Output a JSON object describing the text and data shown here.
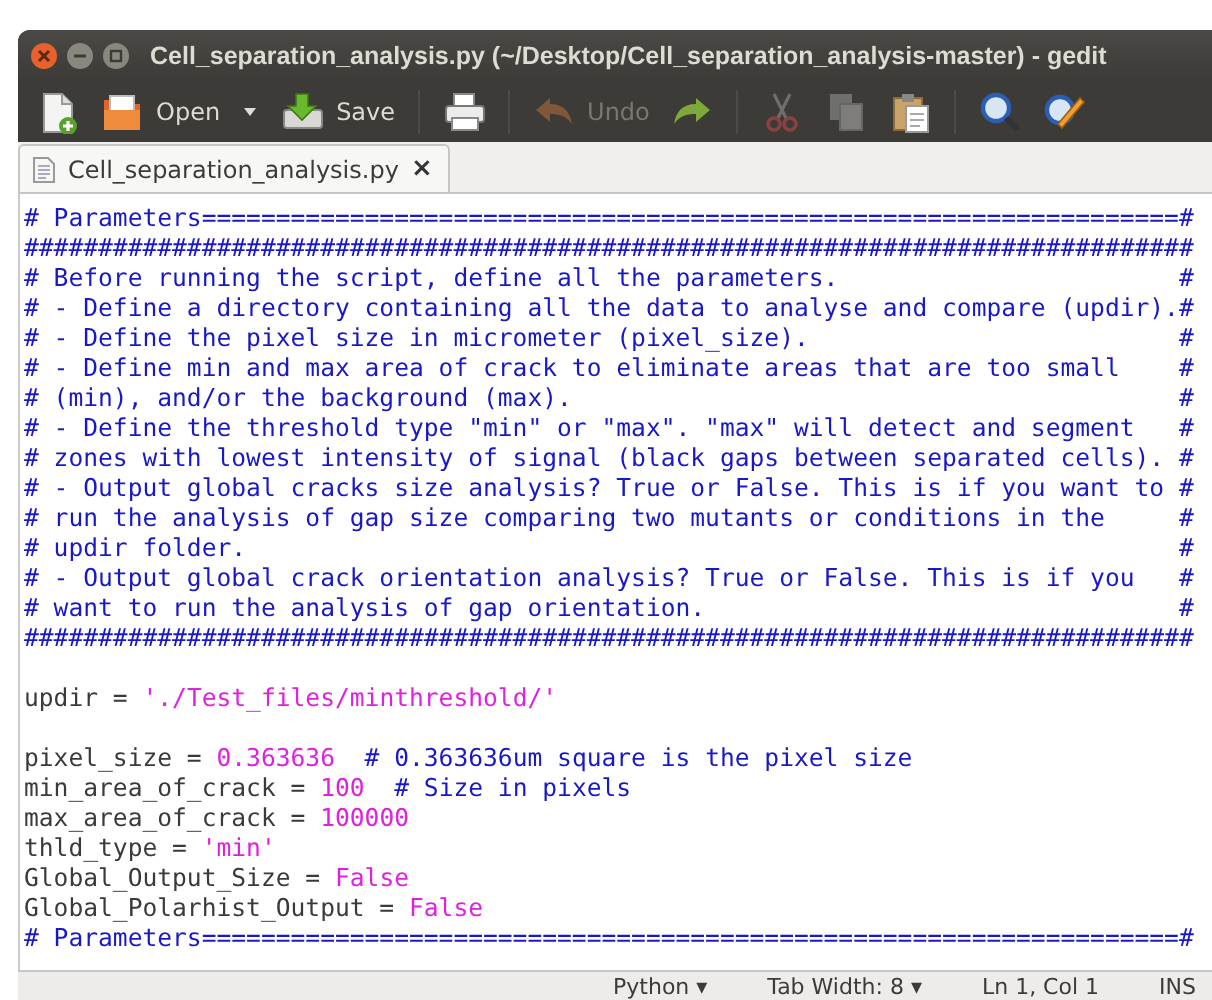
{
  "window": {
    "title": "Cell_separation_analysis.py (~/Desktop/Cell_separation_analysis-master) - gedit"
  },
  "toolbar": [
    {
      "kind": "new",
      "disabled": false
    },
    {
      "kind": "open",
      "label": "Open",
      "disabled": false
    },
    {
      "kind": "save",
      "label": "Save",
      "disabled": false
    },
    {
      "kind": "print",
      "disabled": false
    },
    {
      "kind": "undo",
      "label": "Undo",
      "disabled": true
    },
    {
      "kind": "redo",
      "disabled": false
    },
    {
      "kind": "cut",
      "disabled": true
    },
    {
      "kind": "copy",
      "disabled": true
    },
    {
      "kind": "paste",
      "disabled": false
    },
    {
      "kind": "search",
      "disabled": false
    },
    {
      "kind": "replace",
      "disabled": false
    }
  ],
  "tabs": [
    {
      "label": "Cell_separation_analysis.py",
      "selected": true,
      "close": "×"
    }
  ],
  "lines": [
    {
      "kind": "code",
      "tokens": [
        {
          "kind": "comment",
          "text": "# Parameters==================================================================#"
        }
      ]
    },
    {
      "kind": "code",
      "tokens": [
        {
          "kind": "comment",
          "text": "###############################################################################"
        }
      ]
    },
    {
      "kind": "code",
      "tokens": [
        {
          "kind": "comment",
          "text": "# Before running the script, define all the parameters.                       #"
        }
      ]
    },
    {
      "kind": "code",
      "tokens": [
        {
          "kind": "comment",
          "text": "# - Define a directory containing all the data to analyse and compare (updir).#"
        }
      ]
    },
    {
      "kind": "code",
      "tokens": [
        {
          "kind": "comment",
          "text": "# - Define the pixel size in micrometer (pixel_size).                         #"
        }
      ]
    },
    {
      "kind": "code",
      "tokens": [
        {
          "kind": "comment",
          "text": "# - Define min and max area of crack to eliminate areas that are too small    #"
        }
      ]
    },
    {
      "kind": "code",
      "tokens": [
        {
          "kind": "comment",
          "text": "# (min), and/or the background (max).                                         #"
        }
      ]
    },
    {
      "kind": "code",
      "tokens": [
        {
          "kind": "comment",
          "text": "# - Define the threshold type \"min\" or \"max\". \"max\" will detect and segment   #"
        }
      ]
    },
    {
      "kind": "code",
      "tokens": [
        {
          "kind": "comment",
          "text": "# zones with lowest intensity of signal (black gaps between separated cells). #"
        }
      ]
    },
    {
      "kind": "code",
      "tokens": [
        {
          "kind": "comment",
          "text": "# - Output global cracks size analysis? True or False. This is if you want to #"
        }
      ]
    },
    {
      "kind": "code",
      "tokens": [
        {
          "kind": "comment",
          "text": "# run the analysis of gap size comparing two mutants or conditions in the     #"
        }
      ]
    },
    {
      "kind": "code",
      "tokens": [
        {
          "kind": "comment",
          "text": "# updir folder.                                                               #"
        }
      ]
    },
    {
      "kind": "code",
      "tokens": [
        {
          "kind": "comment",
          "text": "# - Output global crack orientation analysis? True or False. This is if you   #"
        }
      ]
    },
    {
      "kind": "code",
      "tokens": [
        {
          "kind": "comment",
          "text": "# want to run the analysis of gap orientation.                                #"
        }
      ]
    },
    {
      "kind": "code",
      "tokens": [
        {
          "kind": "comment",
          "text": "###############################################################################"
        }
      ]
    },
    {
      "kind": "blank"
    },
    {
      "kind": "code",
      "tokens": [
        {
          "kind": "plain",
          "text": "updir = "
        },
        {
          "kind": "string",
          "text": "'./Test_files/minthreshold/'"
        }
      ]
    },
    {
      "kind": "blank"
    },
    {
      "kind": "code",
      "tokens": [
        {
          "kind": "plain",
          "text": "pixel_size = "
        },
        {
          "kind": "number",
          "text": "0.363636"
        },
        {
          "kind": "comment",
          "text": "  # 0.363636um square is the pixel size"
        }
      ]
    },
    {
      "kind": "code",
      "tokens": [
        {
          "kind": "plain",
          "text": "min_area_of_crack = "
        },
        {
          "kind": "number",
          "text": "100"
        },
        {
          "kind": "comment",
          "text": "  # Size in pixels"
        }
      ]
    },
    {
      "kind": "code",
      "tokens": [
        {
          "kind": "plain",
          "text": "max_area_of_crack = "
        },
        {
          "kind": "number",
          "text": "100000"
        }
      ]
    },
    {
      "kind": "code",
      "tokens": [
        {
          "kind": "plain",
          "text": "thld_type = "
        },
        {
          "kind": "string",
          "text": "'min'"
        }
      ]
    },
    {
      "kind": "code",
      "tokens": [
        {
          "kind": "plain",
          "text": "Global_Output_Size = "
        },
        {
          "kind": "constant",
          "text": "False"
        }
      ]
    },
    {
      "kind": "code",
      "tokens": [
        {
          "kind": "plain",
          "text": "Global_Polarhist_Output = "
        },
        {
          "kind": "constant",
          "text": "False"
        }
      ]
    },
    {
      "kind": "code",
      "tokens": [
        {
          "kind": "comment",
          "text": "# Parameters==================================================================#"
        }
      ]
    }
  ],
  "status_bar": [
    {
      "kind": "menu",
      "label": "Python",
      "caret": "▾"
    },
    {
      "kind": "menu",
      "label": "Tab Width: 8",
      "caret": "▾"
    },
    {
      "kind": "text",
      "label": "Ln 1, Col 1"
    },
    {
      "kind": "text",
      "label": "INS"
    }
  ]
}
